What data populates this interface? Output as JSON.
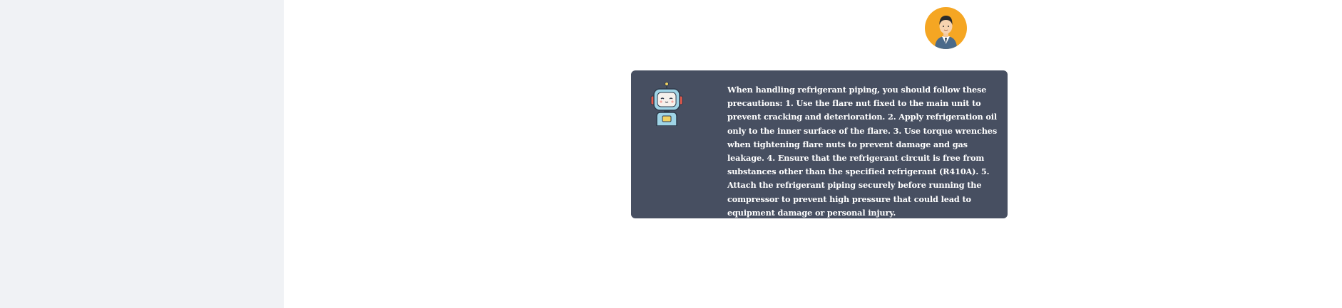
{
  "chat": {
    "user_avatar_icon": "businessman-avatar-icon",
    "bot_avatar_icon": "robot-avatar-icon",
    "messages": [
      {
        "role": "assistant",
        "text": "When handling refrigerant piping, you should follow these precautions: 1. Use the flare nut fixed to the main unit to prevent cracking and deterioration. 2. Apply refrigeration oil only to the inner surface of the flare. 3. Use torque wrenches when tightening flare nuts to prevent damage and gas leakage. 4. Ensure that the refrigerant circuit is free from substances other than the specified refrigerant (R410A). 5. Attach the refrigerant piping securely before running the compressor to prevent high pressure that could lead to equipment damage or personal injury."
      }
    ]
  },
  "colors": {
    "sidebar_bg": "#f0f2f5",
    "bot_bubble_bg": "#474f61",
    "user_avatar_bg": "#f5a623"
  }
}
